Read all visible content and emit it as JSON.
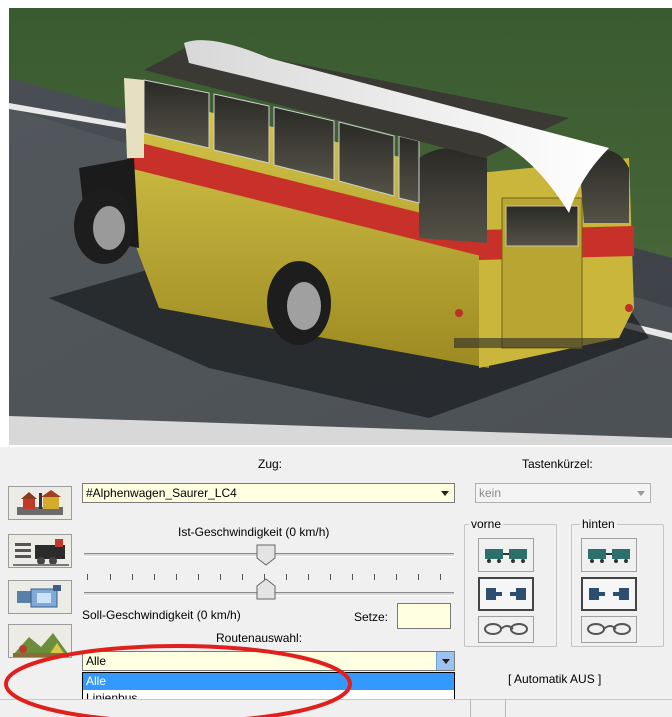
{
  "viewport": {
    "scene": "bus-3d-view"
  },
  "panel": {
    "zug_label": "Zug:",
    "zug_value": "#Alphenwagen_Saurer_LC4",
    "tastenkuerzel_label": "Tastenkürzel:",
    "tastenkuerzel_value": "kein",
    "ist_geschwindigkeit_label": "Ist-Geschwindigkeit (0 km/h)",
    "soll_geschwindigkeit_label": "Soll-Geschwindigkeit (0 km/h)",
    "setze_label": "Setze:",
    "setze_value": "",
    "routenauswahl_label": "Routenauswahl:",
    "routenauswahl_value": "Alle",
    "route_options": [
      "Alle",
      "Linienbus"
    ],
    "vorne_label": "vorne",
    "hinten_label": "hinten",
    "automatik_label": "[ Automatik AUS ]"
  },
  "colors": {
    "field_bg": "#ffffe1",
    "selection": "#3399ff",
    "annotation_circle": "#e0201c"
  },
  "icons": [
    "signal-house-icon",
    "locomotive-icon",
    "camera-icon",
    "landscape-icon",
    "couple-wagons-icon",
    "uncouple-icon",
    "chain-coupler-icon"
  ]
}
